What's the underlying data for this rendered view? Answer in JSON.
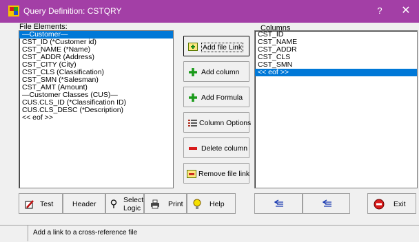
{
  "window": {
    "title": "Query Definition: CSTQRY",
    "help": "?",
    "close": "✕"
  },
  "file_elements": {
    "label": "File Elements:",
    "items": [
      "—Customer—",
      "CST_ID (*Customer id)",
      "CST_NAME (*Name)",
      "CST_ADDR (Address)",
      "CST_CITY (City)",
      "CST_CLS (Classification)",
      "CST_SMN (*Salesman)",
      "CST_AMT (Amount)",
      "—Customer Classes (CUS)—",
      "CUS.CLS_ID (*Classification ID)",
      "CUS.CLS_DESC (*Description)",
      "<< eof >>"
    ],
    "selected_index": 0
  },
  "columns": {
    "label": "Columns",
    "items": [
      "CST_ID",
      "CST_NAME",
      "CST_ADDR",
      "CST_CLS",
      "CST_SMN",
      "<< eof >>"
    ],
    "selected_index": 5
  },
  "side_buttons": {
    "add_file_link": "Add file Link",
    "add_column": "Add column",
    "add_formula": "Add Formula",
    "column_options": "Column Options",
    "delete_column": "Delete column",
    "remove_file_link": "Remove file link"
  },
  "bottom_buttons": {
    "test": "Test",
    "header": "Header",
    "select_logic_1": "Select",
    "select_logic_2": "Logic",
    "print": "Print",
    "help": "Help",
    "exit": "Exit"
  },
  "status": {
    "text": "Add a link to a cross-reference file"
  },
  "colors": {
    "titlebar": "#a33fa6",
    "selection": "#0078d7"
  }
}
